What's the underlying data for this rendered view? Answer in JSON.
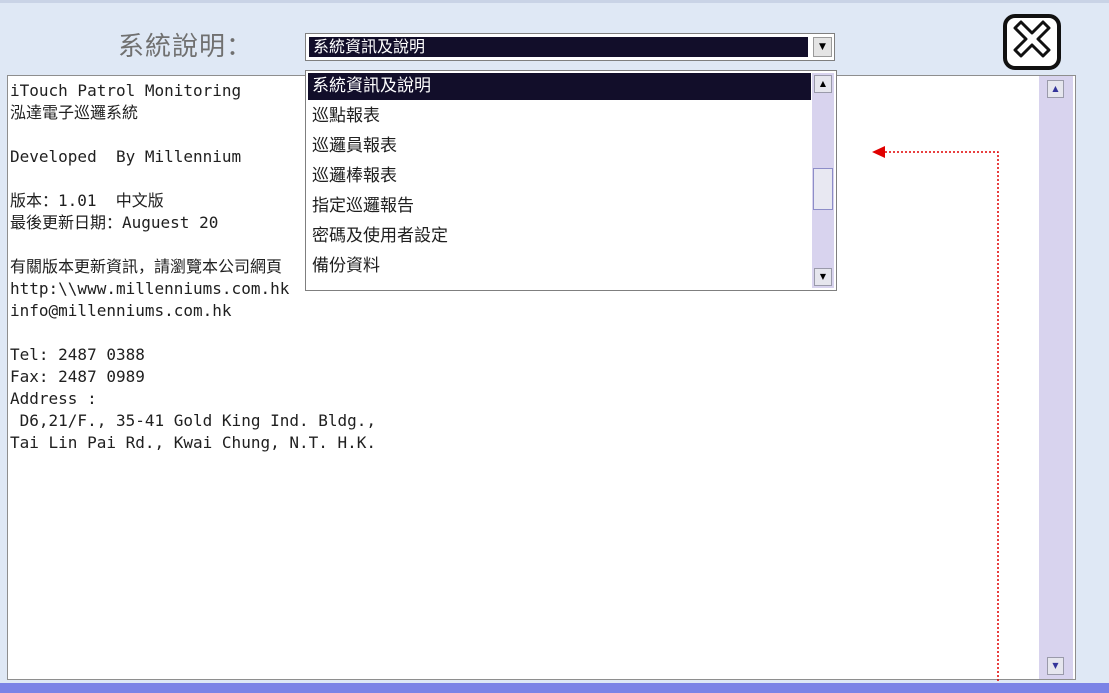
{
  "header": {
    "label": "系統說明：",
    "selected_value": "系統資訊及說明"
  },
  "dropdown": {
    "items": [
      {
        "label": "系統資訊及說明",
        "selected": true
      },
      {
        "label": "巡點報表",
        "selected": false
      },
      {
        "label": "巡邏員報表",
        "selected": false
      },
      {
        "label": "巡邏棒報表",
        "selected": false
      },
      {
        "label": "指定巡邏報告",
        "selected": false
      },
      {
        "label": "密碼及使用者設定",
        "selected": false
      },
      {
        "label": "備份資料",
        "selected": false
      }
    ]
  },
  "content": {
    "lines": [
      "iTouch Patrol Monitoring",
      "泓達電子巡邏系統",
      "",
      "Developed  By Millennium",
      "",
      "版本：1.01  中文版",
      "最後更新日期：Auguest 20",
      "",
      "有關版本更新資訊，請瀏覽本公司網頁",
      "http:\\\\www.millenniums.com.hk",
      "info@millenniums.com.hk",
      "",
      "Tel: 2487 0388",
      "Fax: 2487 0989",
      "Address :",
      " D6,21/F., 35-41 Gold King Ind. Bldg.,",
      "Tai Lin Pai Rd., Kwai Chung, N.T. H.K."
    ]
  },
  "icons": {
    "close": "close-icon",
    "dropdown_arrow": "chevron-down-icon",
    "scroll_up": "scroll-up-icon",
    "scroll_down": "scroll-down-icon"
  },
  "colors": {
    "selection_bg": "#120e2a",
    "annotation_arrow": "#e00000",
    "bottom_bar": "#7b83e6"
  }
}
